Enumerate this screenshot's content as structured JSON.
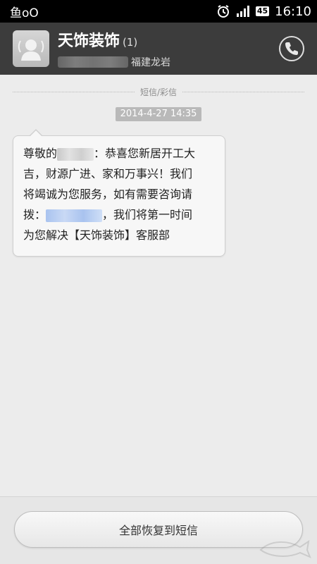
{
  "status_bar": {
    "carrier": "鱼oO",
    "battery": "45",
    "time": "16:10",
    "icons": [
      "alarm-icon",
      "signal-icon",
      "battery-icon"
    ]
  },
  "header": {
    "contact_name": "天饰装饰",
    "message_count": "(1)",
    "location": "福建龙岩",
    "icons": [
      "avatar-icon",
      "phone-icon"
    ]
  },
  "thread": {
    "divider_label": "短信/彩信",
    "timestamp": "2014-4-27 14:35",
    "message": {
      "line1_prefix": "尊敬的",
      "line1_suffix": "：恭喜您新居开工大",
      "line2": "吉，财源广进、家和万事兴！我们",
      "line3": "将竭诚为您服务，如有需要咨询请",
      "line4_prefix": "拨：",
      "line4_suffix": "，我们将第一时间",
      "line5": "为您解决【天饰装饰】客服部"
    }
  },
  "footer": {
    "restore_label": "全部恢复到短信"
  },
  "colors": {
    "status_bar_bg": "#000000",
    "header_bg": "#3c3c3c",
    "thread_bg": "#ececec",
    "bubble_bg": "#f7f7f7",
    "timestamp_bg": "#b9b9b9"
  }
}
